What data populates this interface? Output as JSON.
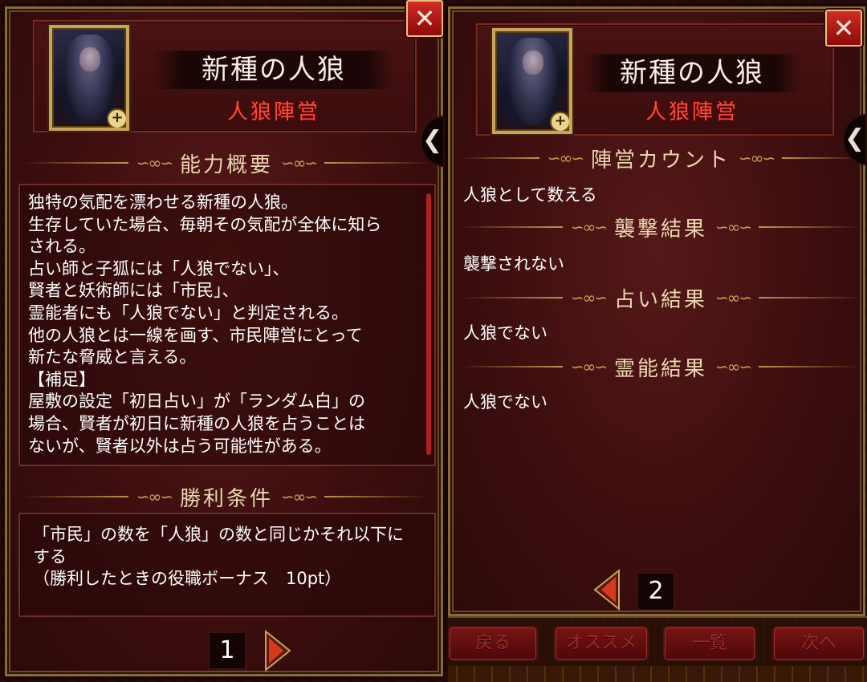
{
  "left": {
    "name": "新種の人狼",
    "faction": "人狼陣営",
    "ability_title": "能力概要",
    "ability_lines": [
      "独特の気配を漂わせる新種の人狼。",
      "生存していた場合、毎朝その気配が全体に知ら",
      "される。",
      "占い師と子狐には「人狼でない」、",
      "賢者と妖術師には「市民」、",
      "霊能者にも「人狼でない」と判定される。",
      "他の人狼とは一線を画す、市民陣営にとって",
      "新たな脅威と言える。",
      "【補足】",
      "屋敷の設定「初日占い」が「ランダム白」の",
      "場合、賢者が初日に新種の人狼を占うことは",
      "ないが、賢者以外は占う可能性がある。"
    ],
    "victory_title": "勝利条件",
    "victory_lines": [
      "「市民」の数を「人狼」の数と同じかそれ以下に",
      "する",
      "（勝利したときの役職ボーナス　10pt）"
    ],
    "page": "1"
  },
  "right": {
    "name": "新種の人狼",
    "faction": "人狼陣営",
    "sections": [
      {
        "title": "陣営カウント",
        "text": "人狼として数える"
      },
      {
        "title": "襲撃結果",
        "text": "襲撃されない"
      },
      {
        "title": "占い結果",
        "text": "人狼でない"
      },
      {
        "title": "霊能結果",
        "text": "人狼でない"
      }
    ],
    "page": "2"
  },
  "icons": {
    "close": "close-icon",
    "zoom": "zoom-icon",
    "next": "next-page-arrow",
    "prev": "prev-page-arrow",
    "side": "chevron-left-icon"
  },
  "close_glyph": "✕",
  "zoom_glyph": "+",
  "side_glyph": "❮",
  "bottom_nav": [
    "戻る",
    "オススメ",
    "一覧",
    "次へ"
  ],
  "colors": {
    "faction": "#ff4a3a",
    "close_button": "#d22b24",
    "frame_gold": "#c9a35a"
  }
}
